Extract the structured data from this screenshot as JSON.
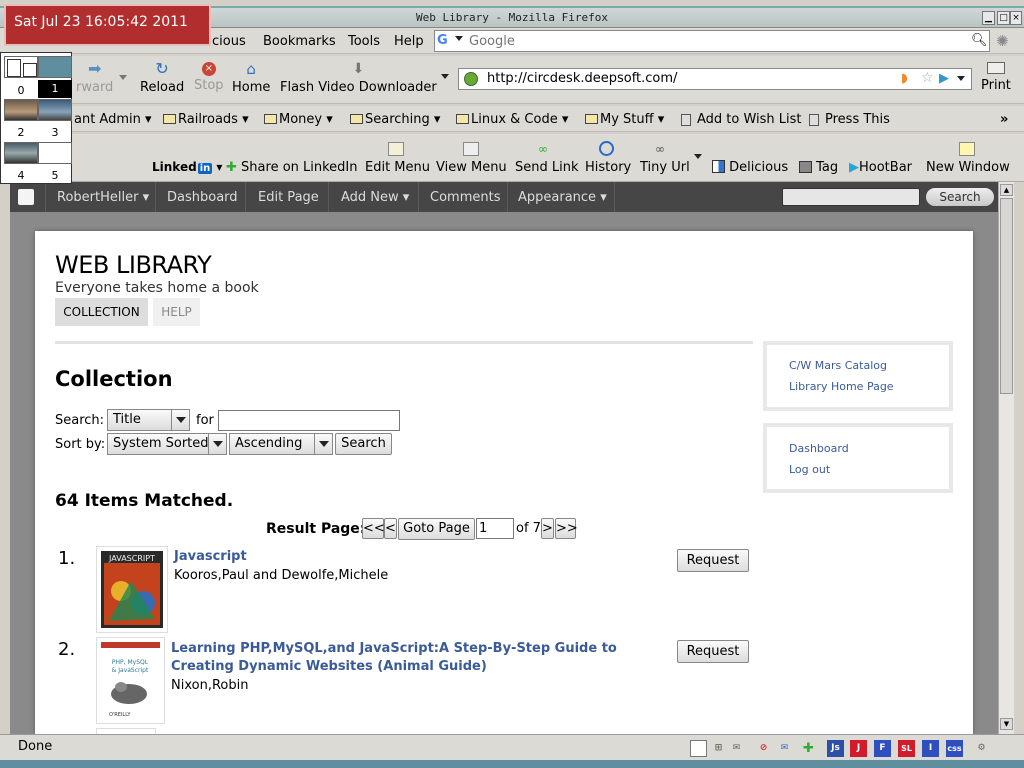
{
  "window": {
    "title": "Web Library - Mozilla Firefox"
  },
  "clock": {
    "text": "Sat Jul 23 16:05:42 2011"
  },
  "pager": {
    "cells": [
      "0",
      "1",
      "2",
      "3",
      "4",
      "5"
    ]
  },
  "menubar": {
    "items": [
      "Delicious",
      "Bookmarks",
      "Tools",
      "Help"
    ],
    "partial_first": "cious"
  },
  "search": {
    "placeholder": "Google"
  },
  "nav": {
    "forward": "rward",
    "reload": "Reload",
    "stop": "Stop",
    "home": "Home",
    "flash": "Flash Video Downloader",
    "url": "http://circdesk.deepsoft.com/",
    "print": "Print"
  },
  "bookmarks": {
    "items": [
      "ant Admin",
      "Railroads",
      "Money",
      "Searching",
      "Linux & Code",
      "My Stuff",
      "Add to Wish List",
      "Press This"
    ],
    "more": "»"
  },
  "toolbar2": {
    "linkedin": "Linked",
    "linkedin_in": "in",
    "share": "Share on LinkedIn",
    "edit_menu": "Edit Menu",
    "view_menu": "View Menu",
    "send_link": "Send Link",
    "history": "History",
    "tiny_url": "Tiny Url",
    "delicious": "Delicious",
    "tag": "Tag",
    "hootbar": "HootBar",
    "new_window": "New Window"
  },
  "wpadmin": {
    "user": "RobertHeller",
    "dashboard": "Dashboard",
    "edit_page": "Edit Page",
    "add_new": "Add New",
    "comments": "Comments",
    "appearance": "Appearance",
    "search_btn": "Search"
  },
  "site": {
    "title": "WEB LIBRARY",
    "tagline": "Everyone takes home a book",
    "tabs": [
      "COLLECTION",
      "HELP"
    ]
  },
  "collection": {
    "heading": "Collection",
    "search_label": "Search:",
    "search_field": "Title",
    "for_label": "for",
    "sort_label": "Sort by:",
    "sort_field": "System Sorted",
    "sort_order": "Ascending",
    "search_button": "Search",
    "matched": "64 Items Matched.",
    "result_label": "Result Page:",
    "first": "<<",
    "prev": "<",
    "goto": "Goto Page",
    "page_value": "1",
    "of_text": "of 7",
    "next": ">",
    "last": ">>",
    "items": [
      {
        "num": "1.",
        "title": "Javascript",
        "author": "Kooros,Paul and Dewolfe,Michele",
        "request": "Request"
      },
      {
        "num": "2.",
        "title": "Learning PHP,MySQL,and JavaScript:A Step-By-Step Guide to Creating Dynamic Websites (Animal Guide)",
        "author": "Nixon,Robin",
        "request": "Request"
      }
    ]
  },
  "sidebar": {
    "links1": [
      "C/W Mars Catalog",
      "Library Home Page"
    ],
    "links2": [
      "Dashboard",
      "Log out"
    ]
  },
  "status": {
    "text": "Done",
    "icons": [
      "Js",
      "J",
      "F",
      "SL",
      "I",
      "css"
    ]
  },
  "colors": {
    "clock_bg": "#b22e2e",
    "wpbar": "#464646",
    "link": "#3a5a99"
  }
}
